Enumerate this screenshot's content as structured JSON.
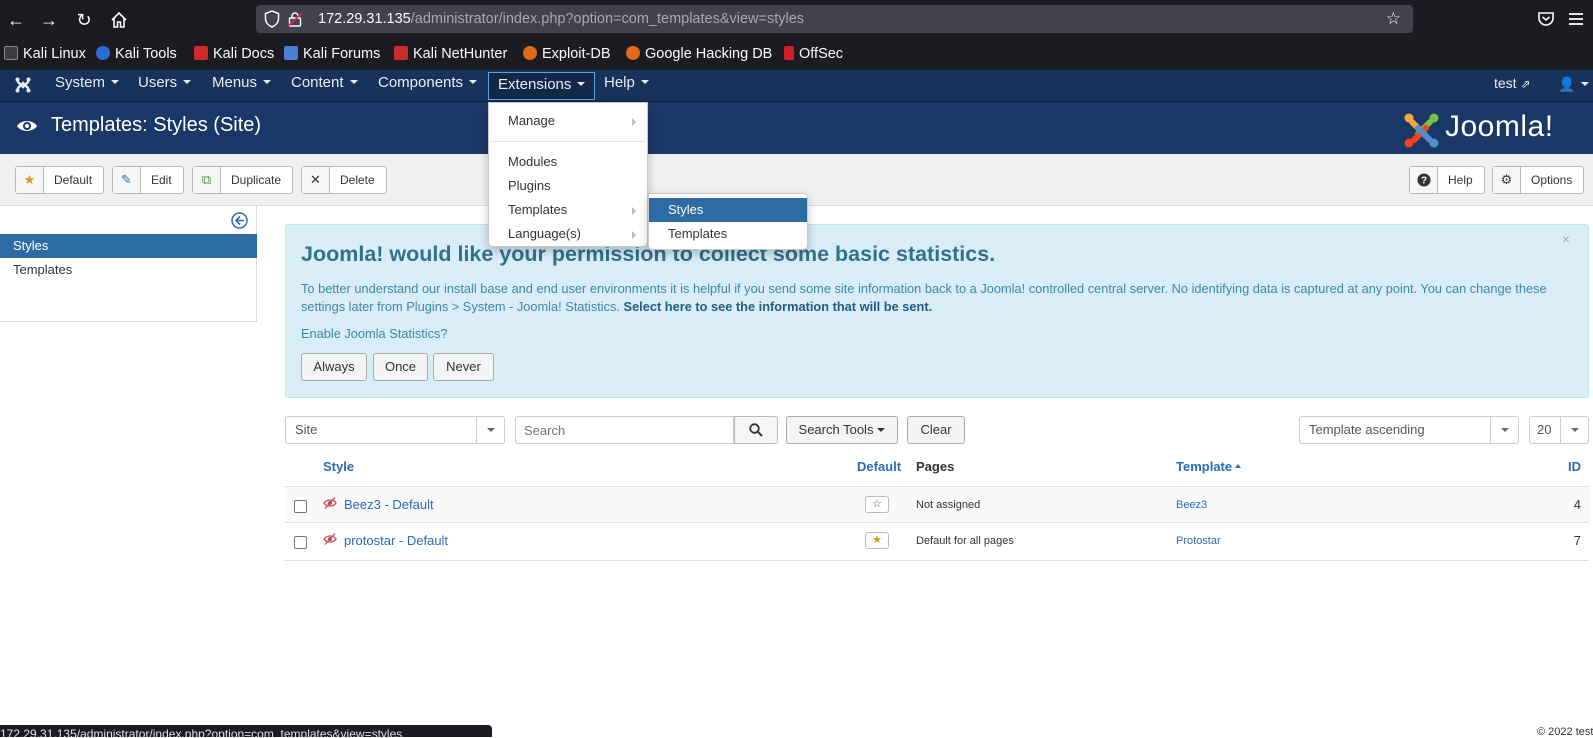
{
  "browser": {
    "url_host": "172.29.31.135",
    "url_path": "/administrator/index.php?option=com_templates&view=styles",
    "bookmarks": [
      "Kali Linux",
      "Kali Tools",
      "Kali Docs",
      "Kali Forums",
      "Kali NetHunter",
      "Exploit-DB",
      "Google Hacking DB",
      "OffSec"
    ],
    "status_url": "172.29.31.135/administrator/index.php?option=com_templates&view=styles"
  },
  "navbar": {
    "menus": [
      "System",
      "Users",
      "Menus",
      "Content",
      "Components",
      "Extensions",
      "Help"
    ],
    "active_menu": "Extensions",
    "user": "test"
  },
  "extensions_menu": {
    "items": [
      "Manage",
      "Modules",
      "Plugins",
      "Templates",
      "Language(s)"
    ]
  },
  "templates_submenu": {
    "items": [
      "Styles",
      "Templates"
    ],
    "highlighted": "Styles"
  },
  "header": {
    "title": "Templates: Styles (Site)",
    "brand": "Joomla!"
  },
  "toolbar": {
    "default_label": "Default",
    "edit_label": "Edit",
    "duplicate_label": "Duplicate",
    "delete_label": "Delete",
    "help_label": "Help",
    "options_label": "Options"
  },
  "sidebar": {
    "items": [
      "Styles",
      "Templates"
    ],
    "active": "Styles"
  },
  "stats_alert": {
    "close": "×",
    "title": "Joomla! would like your permission to collect some basic statistics.",
    "text": "To better understand our install base and end user environments it is helpful if you send some site information back to a Joomla! controlled central server. No identifying data is captured at any point. You can change these settings later from Plugins > System - Joomla! Statistics.",
    "link_text": "Select here to see the information that will be sent.",
    "question": "Enable Joomla Statistics?",
    "buttons": [
      "Always",
      "Once",
      "Never"
    ]
  },
  "filters": {
    "client": "Site",
    "search_placeholder": "Search",
    "search_tools": "Search Tools",
    "clear": "Clear",
    "ordering": "Template ascending",
    "limit": "20"
  },
  "table": {
    "headers": {
      "style": "Style",
      "default": "Default",
      "pages": "Pages",
      "template": "Template",
      "id": "ID"
    },
    "rows": [
      {
        "style": "Beez3 - Default",
        "default": false,
        "pages": "Not assigned",
        "template": "Beez3",
        "id": "4"
      },
      {
        "style": "protostar - Default",
        "default": true,
        "pages": "Default for all pages",
        "template": "Protostar",
        "id": "7"
      }
    ]
  },
  "footer": {
    "copyright": "© 2022 test"
  },
  "colors": {
    "navbar": "#17325b",
    "header": "#1a3867",
    "accent": "#2d6ca2",
    "alert_bg": "#d9edf7",
    "star": "#f0a000"
  }
}
